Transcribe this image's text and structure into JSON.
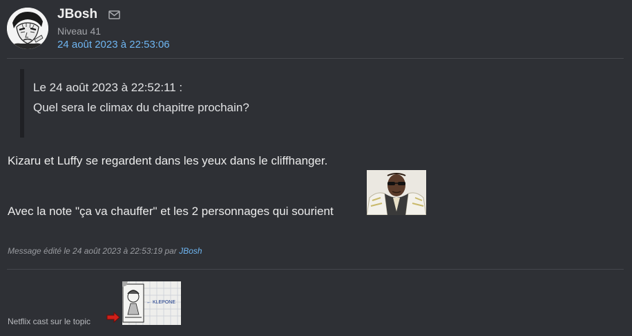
{
  "author": {
    "name": "JBosh",
    "level": "Niveau 41",
    "avatar_icon": "manga-avatar",
    "mail_icon": "envelope-icon"
  },
  "post": {
    "timestamp": "24 août 2023 à 22:53:06",
    "quote": {
      "header": "Le 24 août 2023 à 22:52:11 :",
      "text": "Quel sera le climax du chapitre prochain?"
    },
    "paragraphs": [
      "Kizaru et Luffy se regardent dans les yeux dans le cliffhanger.",
      "Avec la note \"ça va chauffer\" et les 2 personnages qui sourient"
    ],
    "inline_sticker": "kizaru-sticker",
    "edit_note": {
      "prefix": "Message édité le 24 août 2023 à 22:53:19 par",
      "author": "JBosh"
    }
  },
  "signature": {
    "text": "Netflix cast sur le topic",
    "arrow_icon": "red-arrow-icon",
    "sticker": "sketch-sticker",
    "sticker_caption": "← KLEPONE"
  },
  "colors": {
    "background": "#2e3035",
    "link": "#6fb6f2",
    "quote_bar": "#1f2024",
    "arrow": "#d0201a"
  }
}
